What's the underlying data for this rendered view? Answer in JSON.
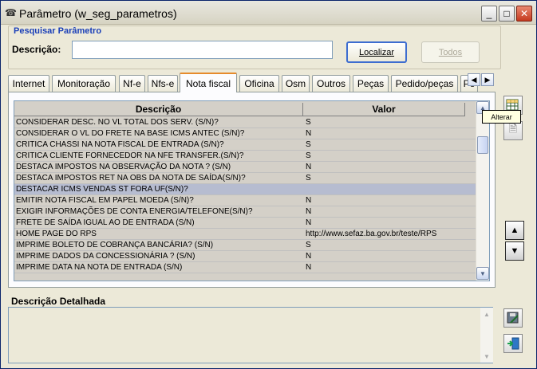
{
  "window": {
    "title": "Parâmetro (w_seg_parametros)",
    "minimize_glyph": "_",
    "maximize_glyph": "□",
    "close_glyph": "✕"
  },
  "search": {
    "section_label": "Pesquisar Parâmetro",
    "description_label": "Descrição:",
    "description_value": "",
    "localizar_label": "Localizar",
    "todos_label": "Todos"
  },
  "tabs": [
    {
      "label": "Internet"
    },
    {
      "label": "Monitoração"
    },
    {
      "label": "Nf-e"
    },
    {
      "label": "Nfs-e"
    },
    {
      "label": "Nota fiscal",
      "active": true
    },
    {
      "label": "Oficina"
    },
    {
      "label": "Osm"
    },
    {
      "label": "Outros"
    },
    {
      "label": "Peças"
    },
    {
      "label": "Pedido/peças"
    },
    {
      "label": "Pe"
    }
  ],
  "grid": {
    "columns": [
      "Descrição",
      "Valor"
    ],
    "rows": [
      {
        "descricao": "CONSIDERAR DESC. NO VL TOTAL DOS SERV. (S/N)?",
        "valor": "S"
      },
      {
        "descricao": "CONSIDERAR O VL DO FRETE NA BASE ICMS ANTEC (S/N)?",
        "valor": "N"
      },
      {
        "descricao": "CRITICA CHASSI NA NOTA FISCAL DE ENTRADA (S/N)?",
        "valor": "S"
      },
      {
        "descricao": "CRITICA CLIENTE FORNECEDOR NA NFE TRANSFER.(S/N)?",
        "valor": "S"
      },
      {
        "descricao": "DESTACA IMPOSTOS NA OBSERVAÇÃO DA NOTA ? (S/N)",
        "valor": "N"
      },
      {
        "descricao": "DESTACA IMPOSTOS RET NA OBS DA NOTA DE SAÍDA(S/N)?",
        "valor": "S"
      },
      {
        "descricao": "DESTACAR ICMS VENDAS ST FORA UF(S/N)?",
        "valor": "",
        "selected": true
      },
      {
        "descricao": "EMITIR NOTA FISCAL EM PAPEL MOEDA (S/N)?",
        "valor": "N"
      },
      {
        "descricao": "EXIGIR INFORMAÇÕES DE CONTA ENERGIA/TELEFONE(S/N)?",
        "valor": "N"
      },
      {
        "descricao": "FRETE DE SAÍDA IGUAL AO DE ENTRADA (S/N)",
        "valor": "N"
      },
      {
        "descricao": "HOME PAGE DO RPS",
        "valor": "http://www.sefaz.ba.gov.br/teste/RPS"
      },
      {
        "descricao": "IMPRIME BOLETO DE COBRANÇA BANCÁRIA? (S/N)",
        "valor": "S"
      },
      {
        "descricao": "IMPRIME DADOS DA CONCESSIONÁRIA ? (S/N)",
        "valor": "N"
      },
      {
        "descricao": "IMPRIME DATA NA NOTA DE ENTRADA (S/N)",
        "valor": "N"
      }
    ]
  },
  "tooltip": {
    "text": "Alterar"
  },
  "detail": {
    "label": "Descrição Detalhada",
    "value": ""
  },
  "icons": {
    "alterar": "table-edit-icon",
    "secondary": "page-icon",
    "up": "triangle-up-icon",
    "down": "triangle-down-icon",
    "save": "disk-edit-icon",
    "exit": "door-exit-icon"
  },
  "colors": {
    "accent_label": "#1a3fb8",
    "active_tab_top": "#e68b2c",
    "selected_row": "#b6bcd0"
  }
}
